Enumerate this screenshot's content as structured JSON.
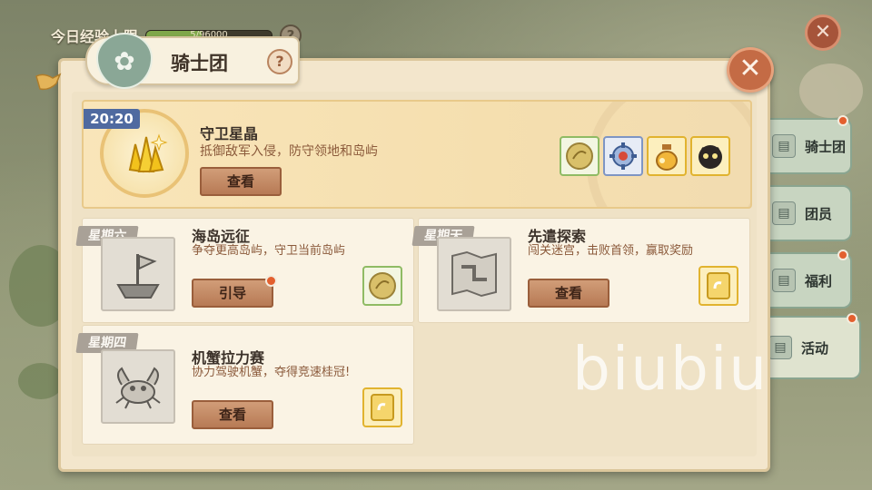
{
  "topbar": {
    "exp_label": "今日经验上限",
    "exp_text": "5/96000",
    "exp_fraction": 0.44,
    "help_glyph": "?"
  },
  "panel": {
    "title": "骑士团",
    "help_glyph": "?",
    "close_glyph": "✕"
  },
  "feature": {
    "time": "20:20",
    "title": "守卫星晶",
    "desc": "抵御敌军入侵，防守领地和岛屿",
    "button": "查看",
    "rewards": [
      "coin-icon",
      "gear-icon",
      "potion-icon",
      "shadow-creature-icon"
    ]
  },
  "cards": [
    {
      "day": "星期六",
      "title": "海岛远征",
      "desc": "争夺更高岛屿，守卫当前岛屿",
      "button": "引导",
      "has_dot": true,
      "icon": "flag-island-icon",
      "reward": "coin-icon"
    },
    {
      "day": "星期天",
      "title": "先遣探索",
      "desc": "闯关迷宫，击败首领，赢取奖励",
      "button": "查看",
      "has_dot": false,
      "icon": "map-icon",
      "reward": "ticket-icon"
    },
    {
      "day": "星期四",
      "title": "机蟹拉力赛",
      "desc": "协力驾驶机蟹，夺得竞速桂冠!",
      "button": "查看",
      "has_dot": false,
      "icon": "crab-icon",
      "reward": "ticket-icon"
    }
  ],
  "side_tabs": [
    {
      "label": "骑士团",
      "dot": true,
      "active": false
    },
    {
      "label": "团员",
      "dot": false,
      "active": false
    },
    {
      "label": "福利",
      "dot": true,
      "active": false
    },
    {
      "label": "活动",
      "dot": true,
      "active": true
    }
  ],
  "watermark": "biubiu",
  "colors": {
    "panel_bg": "#f3e6cc",
    "feature_bg": "#f9e5b9",
    "time_tag": "#4f6aa0",
    "button": "#b77a55",
    "notify_dot": "#e35f2e",
    "side_tab": "#c8d5c1"
  }
}
